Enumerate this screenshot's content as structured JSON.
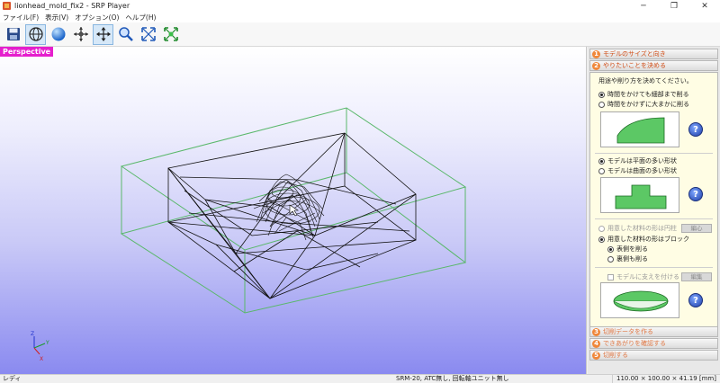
{
  "window": {
    "title": "lionhead_mold_fix2 - SRP Player",
    "minimize": "─",
    "maximize": "❐",
    "close": "✕"
  },
  "menu": [
    "ファイル(F)",
    "表示(V)",
    "オプション(O)",
    "ヘルプ(H)"
  ],
  "toolbar": {
    "tools": [
      {
        "icon": "save-icon",
        "active": false
      },
      {
        "icon": "globe-view-icon",
        "active": true
      },
      {
        "icon": "sphere-shade-icon",
        "active": false
      },
      {
        "icon": "rotate-icon",
        "active": false
      },
      {
        "icon": "pan-icon",
        "active": true
      },
      {
        "icon": "zoom-icon",
        "active": false
      },
      {
        "icon": "fit-view-icon",
        "active": false
      },
      {
        "icon": "zoom-fit-icon",
        "active": false
      }
    ]
  },
  "viewport": {
    "label": "Perspective",
    "axes": {
      "x": "X",
      "y": "Y",
      "z": "Z"
    }
  },
  "panel": {
    "steps": [
      {
        "num": "1",
        "label": "モデルのサイズと向き"
      },
      {
        "num": "2",
        "label": "やりたいことを決める"
      },
      {
        "num": "3",
        "label": "切削データを作る"
      },
      {
        "num": "4",
        "label": "できあがりを確認する"
      },
      {
        "num": "5",
        "label": "切削する"
      }
    ],
    "prompt": "用途や削り方を決めてください。",
    "group1": [
      {
        "label": "時間をかけても細部まで削る",
        "selected": true
      },
      {
        "label": "時間をかけずに大まかに削る",
        "selected": false
      }
    ],
    "group2": [
      {
        "label": "モデルは平面の多い形状",
        "selected": true
      },
      {
        "label": "モデルは曲面の多い形状",
        "selected": false
      }
    ],
    "group3": [
      {
        "label": "用意した材料の形は円柱",
        "selected": false
      },
      {
        "label": "用意した材料の形はブロック",
        "selected": true
      }
    ],
    "group3_sub": [
      {
        "label": "表側を削る",
        "selected": true
      },
      {
        "label": "裏側も削る",
        "selected": false
      }
    ],
    "support_label": "モデルに支えを付ける",
    "button_nav": "編心",
    "button_edit": "編集",
    "help": "?"
  },
  "status": {
    "left": "レディ",
    "machine": "SRM-20, ATC無し, 回転軸ユニット無し",
    "size": "110.00 × 100.00 × 41.19 [mm]"
  },
  "colors": {
    "accent": "#f0873a",
    "viewport_label": "#e51fcd",
    "bbox": "#5ab86b",
    "wire": "#111111",
    "illus_fill": "#5cc865"
  }
}
